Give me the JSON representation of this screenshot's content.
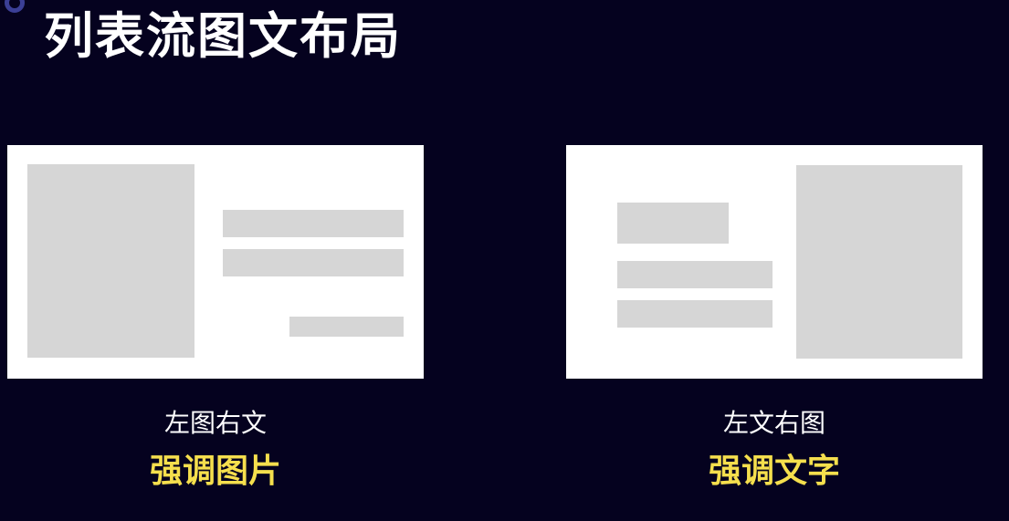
{
  "title": "列表流图文布局",
  "colors": {
    "background": "#05021f",
    "accent_ring": "#3b3f96",
    "card": "#ffffff",
    "placeholder": "#d6d6d6",
    "highlight_text": "#f5df4d"
  },
  "layouts": [
    {
      "layout_name": "左图右文",
      "emphasis": "强调图片"
    },
    {
      "layout_name": "左文右图",
      "emphasis": "强调文字"
    }
  ]
}
